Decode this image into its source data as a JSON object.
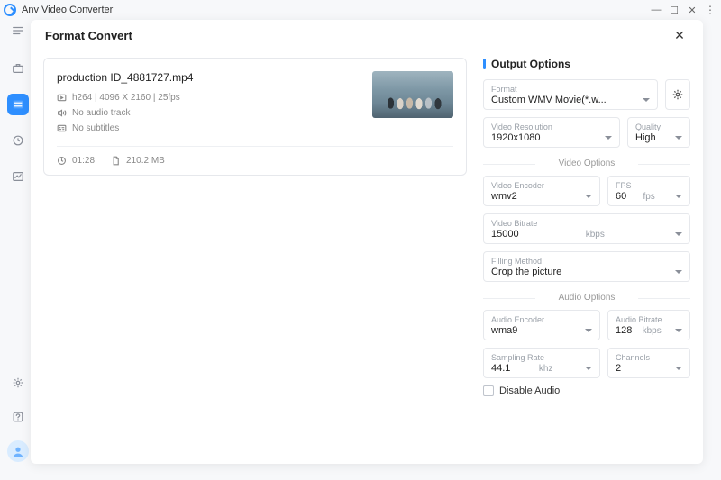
{
  "app": {
    "title": "Anv Video Converter"
  },
  "modal": {
    "title": "Format Convert"
  },
  "file": {
    "name": "production ID_4881727.mp4",
    "codec_line": "h264 | 4096 X 2160 | 25fps",
    "audio_line": "No audio track",
    "subs_line": "No subtitles",
    "duration": "01:28",
    "size": "210.2 MB"
  },
  "output": {
    "heading": "Output Options",
    "format_label": "Format",
    "format_value": "Custom WMV Movie(*.w...",
    "resolution_label": "Video Resolution",
    "resolution_value": "1920x1080",
    "quality_label": "Quality",
    "quality_value": "High",
    "video_options_heading": "Video Options",
    "video_encoder_label": "Video Encoder",
    "video_encoder_value": "wmv2",
    "fps_label": "FPS",
    "fps_value": "60",
    "fps_unit": "fps",
    "video_bitrate_label": "Video Bitrate",
    "video_bitrate_value": "15000",
    "video_bitrate_unit": "kbps",
    "filling_label": "Filling Method",
    "filling_value": "Crop the picture",
    "audio_options_heading": "Audio Options",
    "audio_encoder_label": "Audio Encoder",
    "audio_encoder_value": "wma9",
    "audio_bitrate_label": "Audio Bitrate",
    "audio_bitrate_value": "128",
    "audio_bitrate_unit": "kbps",
    "sampling_label": "Sampling Rate",
    "sampling_value": "44.1",
    "sampling_unit": "khz",
    "channels_label": "Channels",
    "channels_value": "2",
    "disable_audio_label": "Disable Audio"
  }
}
